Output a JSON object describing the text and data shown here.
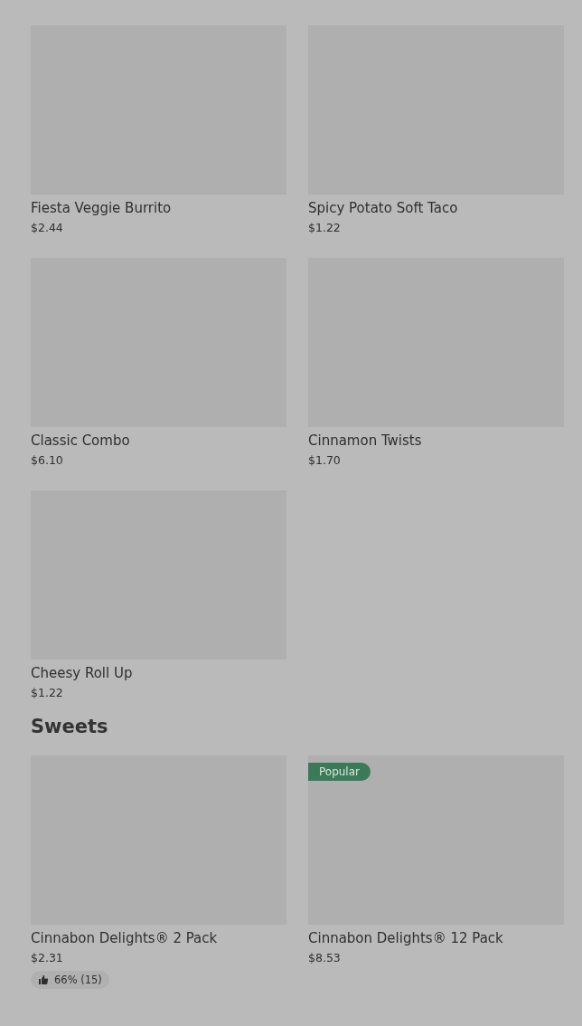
{
  "sections": [
    {
      "items": [
        {
          "name": "Fiesta Veggie Burrito",
          "price": "$2.44"
        },
        {
          "name": "Spicy Potato Soft Taco",
          "price": "$1.22"
        },
        {
          "name": "Classic Combo",
          "price": "$6.10"
        },
        {
          "name": "Cinnamon Twists",
          "price": "$1.70"
        },
        {
          "name": "Cheesy Roll Up",
          "price": "$1.22"
        }
      ]
    },
    {
      "title": "Sweets",
      "items": [
        {
          "name": "Cinnabon Delights® 2 Pack",
          "price": "$2.31",
          "rating": "66% (15)"
        },
        {
          "name": "Cinnabon Delights® 12 Pack",
          "price": "$8.53",
          "badge": "Popular"
        }
      ]
    }
  ]
}
